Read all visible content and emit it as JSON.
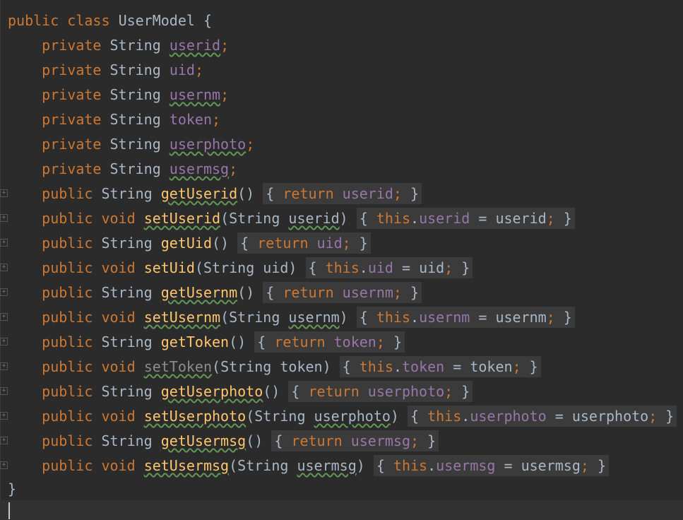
{
  "editor": {
    "language": "java",
    "class_keyword_public": "public",
    "class_keyword_class": "class",
    "class_name": "UserModel",
    "open_brace": "{",
    "close_brace": "}"
  },
  "fields": [
    {
      "mod": "private",
      "type": "String",
      "name": "userid",
      "semi": ";"
    },
    {
      "mod": "private",
      "type": "String",
      "name": "uid",
      "semi": ";"
    },
    {
      "mod": "private",
      "type": "String",
      "name": "usernm",
      "semi": ";"
    },
    {
      "mod": "private",
      "type": "String",
      "name": "token",
      "semi": ";"
    },
    {
      "mod": "private",
      "type": "String",
      "name": "userphoto",
      "semi": ";"
    },
    {
      "mod": "private",
      "type": "String",
      "name": "usermsg",
      "semi": ";"
    }
  ],
  "methods": [
    {
      "kind": "getter",
      "mod": "public",
      "ret": "String",
      "name": "getUserid",
      "params": "()",
      "body_kw": "return",
      "body": "userid"
    },
    {
      "kind": "setter",
      "mod": "public",
      "ret": "void",
      "name": "setUserid",
      "ptype": "String",
      "pname": "userid",
      "this": "this",
      "field": "userid",
      "eq": "=",
      "val": "userid"
    },
    {
      "kind": "getter",
      "mod": "public",
      "ret": "String",
      "name": "getUid",
      "params": "()",
      "body_kw": "return",
      "body": "uid"
    },
    {
      "kind": "setter",
      "mod": "public",
      "ret": "void",
      "name": "setUid",
      "ptype": "String",
      "pname": "uid",
      "this": "this",
      "field": "uid",
      "eq": "=",
      "val": "uid"
    },
    {
      "kind": "getter",
      "mod": "public",
      "ret": "String",
      "name": "getUsernm",
      "params": "()",
      "body_kw": "return",
      "body": "usernm"
    },
    {
      "kind": "setter",
      "mod": "public",
      "ret": "void",
      "name": "setUsernm",
      "ptype": "String",
      "pname": "usernm",
      "this": "this",
      "field": "usernm",
      "eq": "=",
      "val": "usernm"
    },
    {
      "kind": "getter",
      "mod": "public",
      "ret": "String",
      "name": "getToken",
      "params": "()",
      "body_kw": "return",
      "body": "token"
    },
    {
      "kind": "setter",
      "mod": "public",
      "ret": "void",
      "name": "setToken",
      "ptype": "String",
      "pname": "token",
      "this": "this",
      "field": "token",
      "eq": "=",
      "val": "token"
    },
    {
      "kind": "getter",
      "mod": "public",
      "ret": "String",
      "name": "getUserphoto",
      "params": "()",
      "body_kw": "return",
      "body": "userphoto"
    },
    {
      "kind": "setter",
      "mod": "public",
      "ret": "void",
      "name": "setUserphoto",
      "ptype": "String",
      "pname": "userphoto",
      "this": "this",
      "field": "userphoto",
      "eq": "=",
      "val": "userphoto"
    },
    {
      "kind": "getter",
      "mod": "public",
      "ret": "String",
      "name": "getUsermsg",
      "params": "()",
      "body_kw": "return",
      "body": "usermsg"
    },
    {
      "kind": "setter",
      "mod": "public",
      "ret": "void",
      "name": "setUsermsg",
      "ptype": "String",
      "pname": "usermsg",
      "this": "this",
      "field": "usermsg",
      "eq": "=",
      "val": "usermsg"
    }
  ],
  "colors": {
    "background": "#2b2b2b",
    "keyword": "#cc7832",
    "method": "#ffc66d",
    "field": "#9876aa",
    "text": "#a9b7c6"
  },
  "icons": {
    "fold_marker": "fold-icon"
  }
}
